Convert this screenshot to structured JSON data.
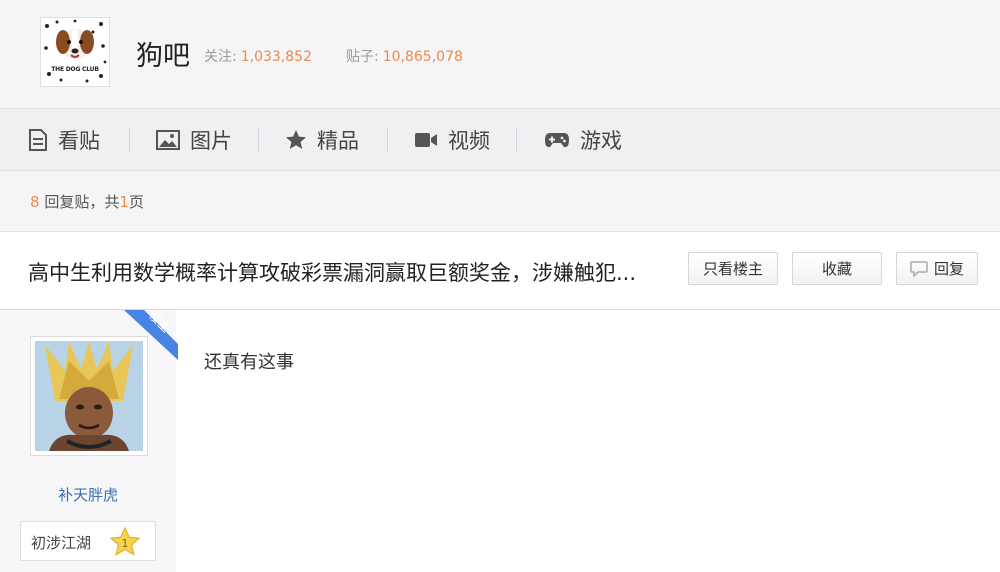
{
  "forum": {
    "name": "狗吧",
    "logo_text": "THE DOG CLUB",
    "follow_label": "关注:",
    "follow_count": "1,033,852",
    "posts_label": "贴子:",
    "posts_count": "10,865,078"
  },
  "nav": [
    {
      "label": "看贴",
      "icon": "document-icon"
    },
    {
      "label": "图片",
      "icon": "image-icon"
    },
    {
      "label": "精品",
      "icon": "star-icon"
    },
    {
      "label": "视频",
      "icon": "video-icon"
    },
    {
      "label": "游戏",
      "icon": "gamepad-icon"
    }
  ],
  "thread_info": {
    "reply_count": "8",
    "reply_suffix": "回复贴，共",
    "page_count": "1",
    "page_suffix": "页"
  },
  "thread": {
    "title": "高中生利用数学概率计算攻破彩票漏洞赢取巨额奖金，涉嫌触犯...",
    "only_op_label": "只看楼主",
    "favorite_label": "收藏",
    "reply_label": "回复"
  },
  "post": {
    "op_badge": "楼主",
    "author": "补天胖虎",
    "level_title": "初涉江湖",
    "level_number": "1",
    "content": "还真有这事"
  },
  "colors": {
    "accent": "#ec8a4b",
    "link": "#3d6db1",
    "badge": "#4a84e2"
  }
}
